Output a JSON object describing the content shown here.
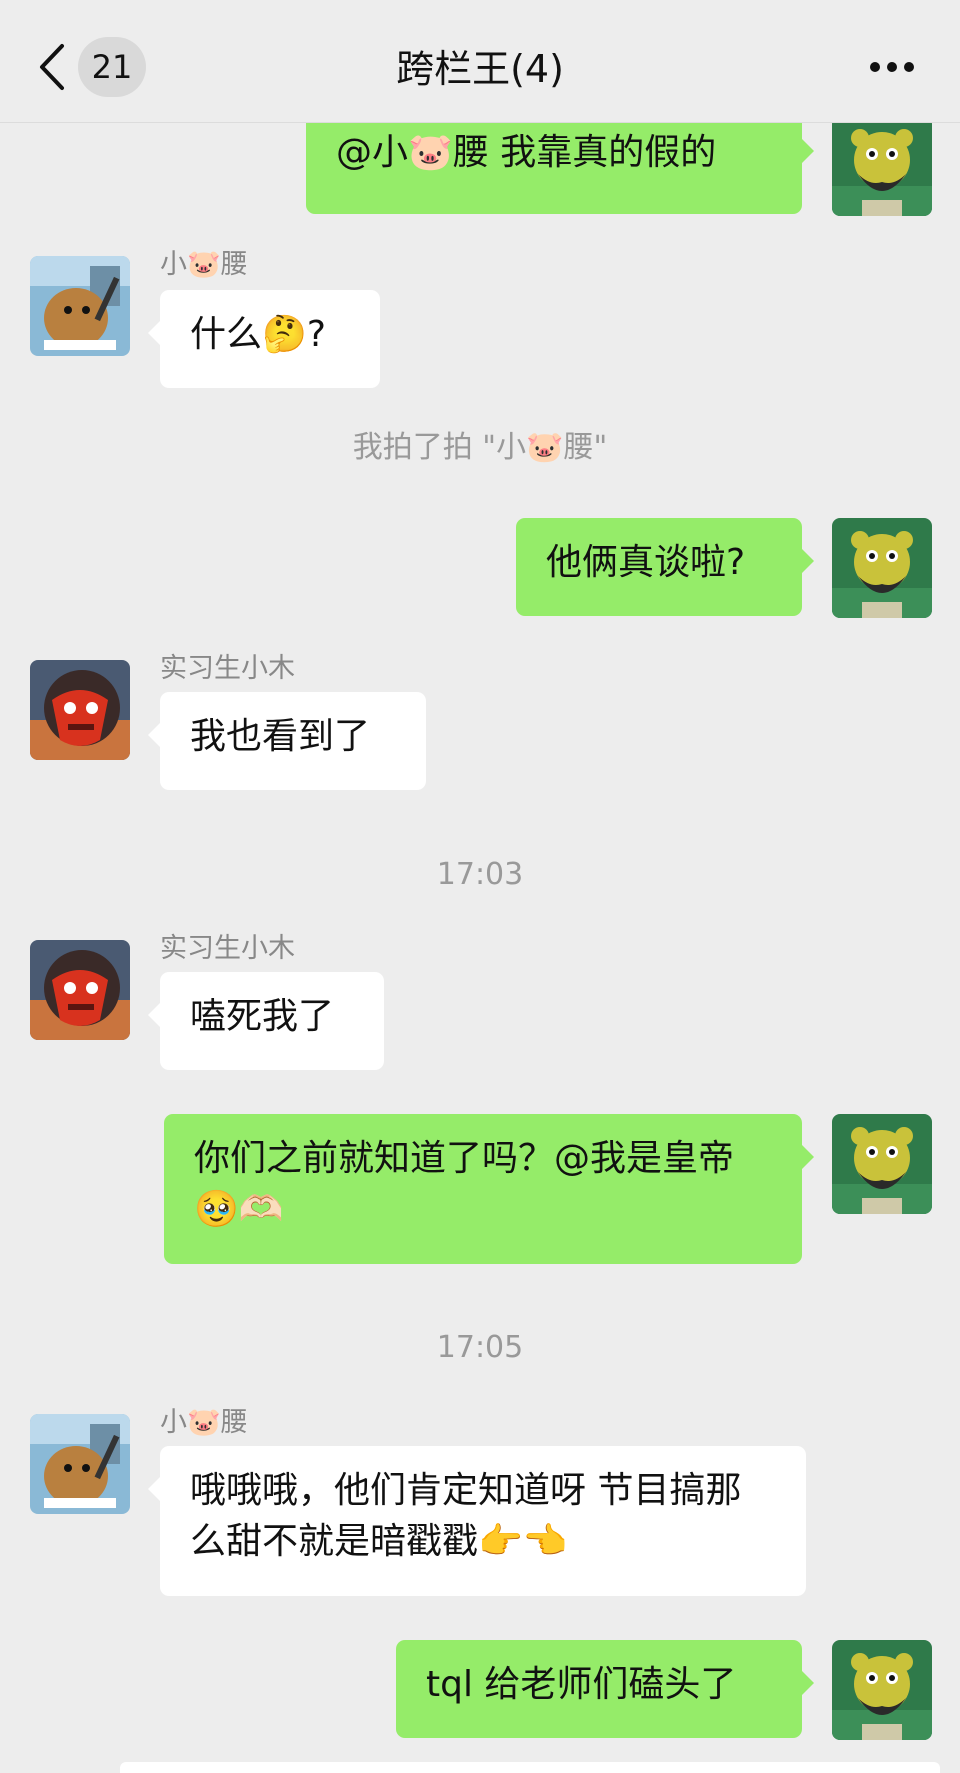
{
  "header": {
    "unread_count": "21",
    "title": "跨栏王(4)"
  },
  "messages": {
    "m1": {
      "side": "right",
      "text": "@小🐷腰 我靠真的假的"
    },
    "m2": {
      "side": "left",
      "sender": "小🐷腰",
      "text": "什么🤔?"
    },
    "sys1": "我拍了拍 \"小🐷腰\"",
    "m3": {
      "side": "right",
      "text": "他俩真谈啦?"
    },
    "m4": {
      "side": "left",
      "sender": "实习生小木",
      "text": "我也看到了"
    },
    "time1": "17:03",
    "m5": {
      "side": "left",
      "sender": "实习生小木",
      "text": "嗑死我了"
    },
    "m6": {
      "side": "right",
      "text": "你们之前就知道了吗？@我是皇帝🥹🫶🏻"
    },
    "time2": "17:05",
    "m7": {
      "side": "left",
      "sender": "小🐷腰",
      "text": "哦哦哦，他们肯定知道呀 节目搞那么甜不就是暗戳戳👉👈"
    },
    "m8": {
      "side": "right",
      "text": "tql 给老师们磕头了"
    }
  },
  "colors": {
    "background": "#ededed",
    "right_bubble": "#95ec69",
    "left_bubble": "#ffffff",
    "meta_text": "#999999"
  },
  "icons": {
    "back": "chevron-left-icon",
    "more": "more-dots-icon"
  }
}
